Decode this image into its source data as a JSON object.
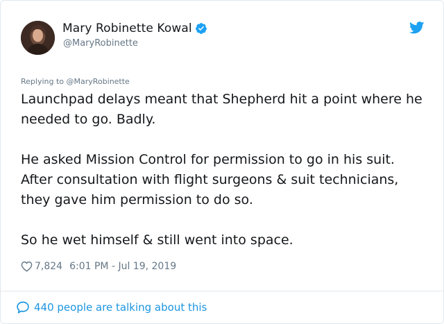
{
  "author": {
    "display_name": "Mary Robinette Kowal",
    "handle": "@MaryRobinette",
    "verified": true
  },
  "reply": {
    "prefix": "Replying to",
    "mention": "@MaryRobinette"
  },
  "tweet": {
    "paragraphs": [
      "Launchpad delays meant that Shepherd hit a point where he needed to go. Badly.",
      "He asked Mission Control for permission to go in his suit. After consultation with flight surgeons & suit technicians, they gave him permission to do so.",
      "So he wet himself & still went into space."
    ],
    "likes": "7,824",
    "timestamp": "6:01 PM - Jul 19, 2019"
  },
  "footer": {
    "talking_text": "440 people are talking about this"
  },
  "colors": {
    "accent": "#1b95e0",
    "secondary_text": "#657786",
    "primary_text": "#14171a",
    "border": "#e1e8ed"
  },
  "icons": [
    "avatar",
    "verified-badge-icon",
    "twitter-bird-icon",
    "heart-icon",
    "speech-bubble-icon"
  ]
}
